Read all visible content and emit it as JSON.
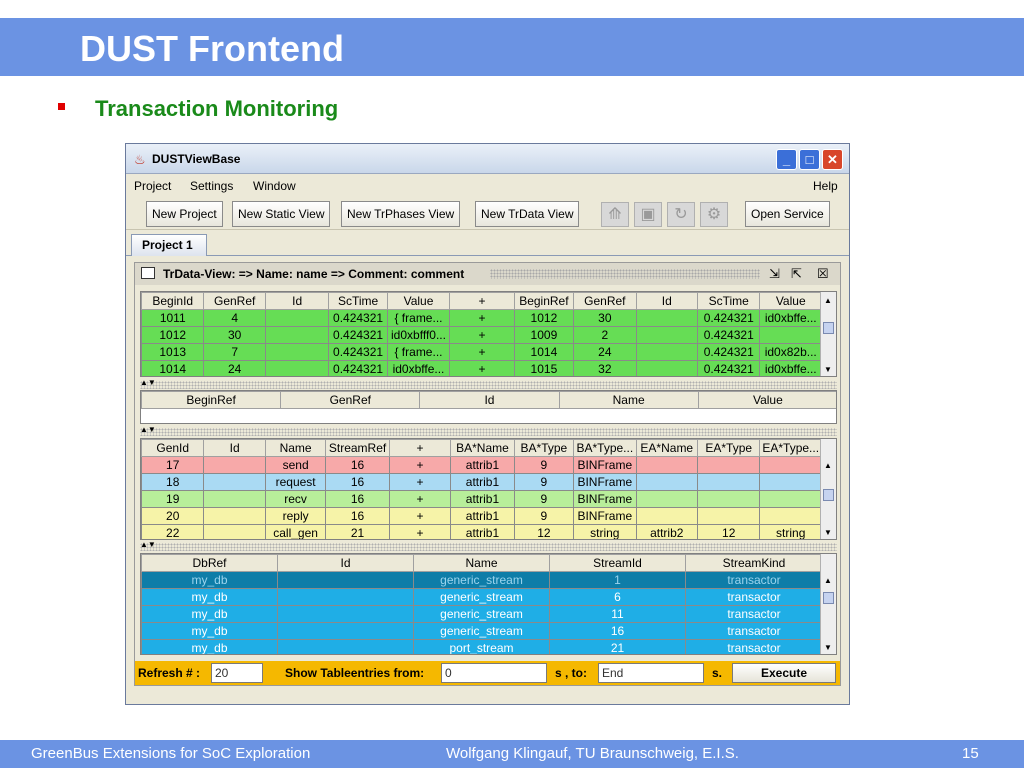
{
  "slide": {
    "title": "DUST Frontend",
    "subtitle": "Transaction Monitoring",
    "footer_left": "GreenBus Extensions for SoC Exploration",
    "footer_center": "Wolfgang Klingauf, TU Braunschweig, E.I.S.",
    "footer_page": "15"
  },
  "window": {
    "title": "DUSTViewBase",
    "menu": [
      "Project",
      "Settings",
      "Window"
    ],
    "help": "Help",
    "toolbar_buttons": [
      "New Project",
      "New Static View",
      "New TrPhases View",
      "New TrData View"
    ],
    "open_service": "Open Service",
    "tab": "Project 1"
  },
  "inner": {
    "title": "TrData-View:  => Name: name => Comment: comment"
  },
  "table1": {
    "headers": [
      "BeginId",
      "GenRef",
      "Id",
      "ScTime",
      "Value",
      "+",
      "BeginRef",
      "GenRef",
      "Id",
      "ScTime",
      "Value"
    ],
    "rows": [
      [
        "1011",
        "4",
        "",
        "0.424321",
        "{  frame...",
        "+",
        "1012",
        "30",
        "",
        "0.424321",
        "id0xbffe..."
      ],
      [
        "1012",
        "30",
        "",
        "0.424321",
        "id0xbfff0...",
        "+",
        "1009",
        "2",
        "",
        "0.424321",
        ""
      ],
      [
        "1013",
        "7",
        "",
        "0.424321",
        "{  frame...",
        "+",
        "1014",
        "24",
        "",
        "0.424321",
        "id0x82b..."
      ],
      [
        "1014",
        "24",
        "",
        "0.424321",
        "id0xbffe...",
        "+",
        "1015",
        "32",
        "",
        "0.424321",
        "id0xbffe..."
      ]
    ]
  },
  "table2": {
    "headers": [
      "BeginRef",
      "GenRef",
      "Id",
      "Name",
      "Value"
    ]
  },
  "table3": {
    "headers": [
      "GenId",
      "Id",
      "Name",
      "StreamRef",
      "+",
      "BA*Name",
      "BA*Type",
      "BA*Type...",
      "EA*Name",
      "EA*Type",
      "EA*Type..."
    ],
    "rows": [
      [
        "17",
        "",
        "send",
        "16",
        "+",
        "attrib1",
        "9",
        "BINFrame",
        "",
        "",
        ""
      ],
      [
        "18",
        "",
        "request",
        "16",
        "+",
        "attrib1",
        "9",
        "BINFrame",
        "",
        "",
        ""
      ],
      [
        "19",
        "",
        "recv",
        "16",
        "+",
        "attrib1",
        "9",
        "BINFrame",
        "",
        "",
        ""
      ],
      [
        "20",
        "",
        "reply",
        "16",
        "+",
        "attrib1",
        "9",
        "BINFrame",
        "",
        "",
        ""
      ],
      [
        "22",
        "",
        "call_gen",
        "21",
        "+",
        "attrib1",
        "12",
        "string",
        "attrib2",
        "12",
        "string"
      ]
    ]
  },
  "table4": {
    "headers": [
      "DbRef",
      "Id",
      "Name",
      "StreamId",
      "StreamKind"
    ],
    "rows": [
      [
        "my_db",
        "",
        "generic_stream",
        "1",
        "transactor"
      ],
      [
        "my_db",
        "",
        "generic_stream",
        "6",
        "transactor"
      ],
      [
        "my_db",
        "",
        "generic_stream",
        "11",
        "transactor"
      ],
      [
        "my_db",
        "",
        "generic_stream",
        "16",
        "transactor"
      ],
      [
        "my_db",
        "",
        "port_stream",
        "21",
        "transactor"
      ]
    ]
  },
  "controls": {
    "refresh_label": "Refresh # :",
    "refresh_value": "20",
    "show_label": "Show Tableentries from:",
    "from_value": "0",
    "to_label": "s , to:",
    "to_value": "End",
    "s_label": "s.",
    "execute": "Execute"
  },
  "colors": {
    "title_bar": "#6b93e3",
    "subtitle": "#1a8a1a",
    "controls_bar": "#f5b800"
  }
}
